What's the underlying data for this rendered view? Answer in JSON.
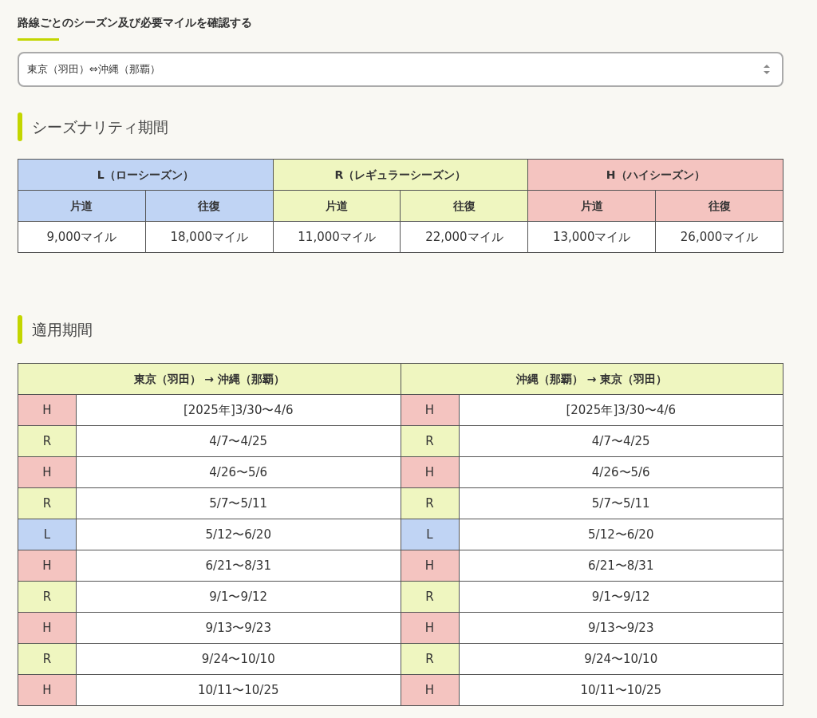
{
  "title": "路線ごとのシーズン及び必要マイルを確認する",
  "route_select": {
    "value": "東京（羽田）⇔沖縄（那覇）"
  },
  "seasonality": {
    "heading": "シーズナリティ期間",
    "seasons": [
      {
        "name": "L（ローシーズン）",
        "color": "#c0d4f4",
        "one_way_label": "片道",
        "round_trip_label": "往復",
        "one_way": "9,000マイル",
        "round_trip": "18,000マイル"
      },
      {
        "name": "R（レギュラーシーズン）",
        "color": "#eff6c0",
        "one_way_label": "片道",
        "round_trip_label": "往復",
        "one_way": "11,000マイル",
        "round_trip": "22,000マイル"
      },
      {
        "name": "H（ハイシーズン）",
        "color": "#f4c4c0",
        "one_way_label": "片道",
        "round_trip_label": "往復",
        "one_way": "13,000マイル",
        "round_trip": "26,000マイル"
      }
    ]
  },
  "periods": {
    "heading": "適用期間",
    "directions": [
      {
        "title": "東京（羽田） → 沖縄（那覇）",
        "rows": [
          {
            "season": "H",
            "color": "#f4c4c0",
            "dates": "[2025年]3/30〜4/6"
          },
          {
            "season": "R",
            "color": "#eff6c0",
            "dates": "4/7〜4/25"
          },
          {
            "season": "H",
            "color": "#f4c4c0",
            "dates": "4/26〜5/6"
          },
          {
            "season": "R",
            "color": "#eff6c0",
            "dates": "5/7〜5/11"
          },
          {
            "season": "L",
            "color": "#c0d4f4",
            "dates": "5/12〜6/20"
          },
          {
            "season": "H",
            "color": "#f4c4c0",
            "dates": "6/21〜8/31"
          },
          {
            "season": "R",
            "color": "#eff6c0",
            "dates": "9/1〜9/12"
          },
          {
            "season": "H",
            "color": "#f4c4c0",
            "dates": "9/13〜9/23"
          },
          {
            "season": "R",
            "color": "#eff6c0",
            "dates": "9/24〜10/10"
          },
          {
            "season": "H",
            "color": "#f4c4c0",
            "dates": "10/11〜10/25"
          }
        ]
      },
      {
        "title": "沖縄（那覇） → 東京（羽田）",
        "rows": [
          {
            "season": "H",
            "color": "#f4c4c0",
            "dates": "[2025年]3/30〜4/6"
          },
          {
            "season": "R",
            "color": "#eff6c0",
            "dates": "4/7〜4/25"
          },
          {
            "season": "H",
            "color": "#f4c4c0",
            "dates": "4/26〜5/6"
          },
          {
            "season": "R",
            "color": "#eff6c0",
            "dates": "5/7〜5/11"
          },
          {
            "season": "L",
            "color": "#c0d4f4",
            "dates": "5/12〜6/20"
          },
          {
            "season": "H",
            "color": "#f4c4c0",
            "dates": "6/21〜8/31"
          },
          {
            "season": "R",
            "color": "#eff6c0",
            "dates": "9/1〜9/12"
          },
          {
            "season": "H",
            "color": "#f4c4c0",
            "dates": "9/13〜9/23"
          },
          {
            "season": "R",
            "color": "#eff6c0",
            "dates": "9/24〜10/10"
          },
          {
            "season": "H",
            "color": "#f4c4c0",
            "dates": "10/11〜10/25"
          }
        ]
      }
    ]
  }
}
